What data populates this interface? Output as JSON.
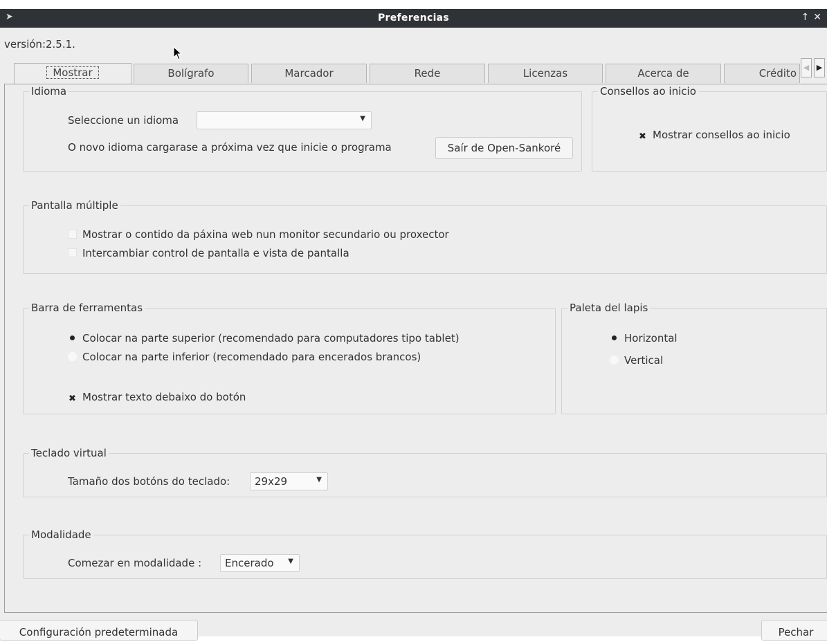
{
  "window": {
    "title": "Preferencias"
  },
  "version": "versión:2.5.1.",
  "tabs": [
    "Mostrar",
    "Bolígrafo",
    "Marcador",
    "Rede",
    "Licenzas",
    "Acerca de",
    "Crédito"
  ],
  "idioma": {
    "legend": "Idioma",
    "select_label": "Seleccione un idioma",
    "select_value": "",
    "note": "O novo idioma cargarase a próxima vez que inicie o programa",
    "exit_button": "Saír de Open-Sankoré"
  },
  "consellos": {
    "legend": "Consellos ao inicio",
    "checkbox_label": "Mostrar consellos ao inicio",
    "checked": true
  },
  "pantalla": {
    "legend": "Pantalla múltiple",
    "options": [
      {
        "label": "Mostrar o contido da páxina web nun monitor secundario ou proxector",
        "checked": false
      },
      {
        "label": "Intercambiar control de pantalla e vista de pantalla",
        "checked": false
      }
    ]
  },
  "barra": {
    "legend": "Barra de ferramentas",
    "radios": [
      {
        "label": "Colocar na parte superior (recomendado para computadores tipo tablet)",
        "selected": true
      },
      {
        "label": "Colocar na parte inferior (recomendado para encerados brancos)",
        "selected": false
      }
    ],
    "text_below_label": "Mostrar texto debaixo do botón",
    "text_below_checked": true
  },
  "paleta": {
    "legend": "Paleta del lapis",
    "radios": [
      {
        "label": "Horizontal",
        "selected": true
      },
      {
        "label": "Vertical",
        "selected": false
      }
    ]
  },
  "teclado": {
    "legend": "Teclado virtual",
    "label": "Tamaño dos botóns do teclado:",
    "value": "29x29"
  },
  "modalidade": {
    "legend": "Modalidade",
    "label": "Comezar en modalidade :",
    "value": "Encerado"
  },
  "footer": {
    "default_button": "Configuración predeterminada",
    "close_button": "Pechar"
  }
}
